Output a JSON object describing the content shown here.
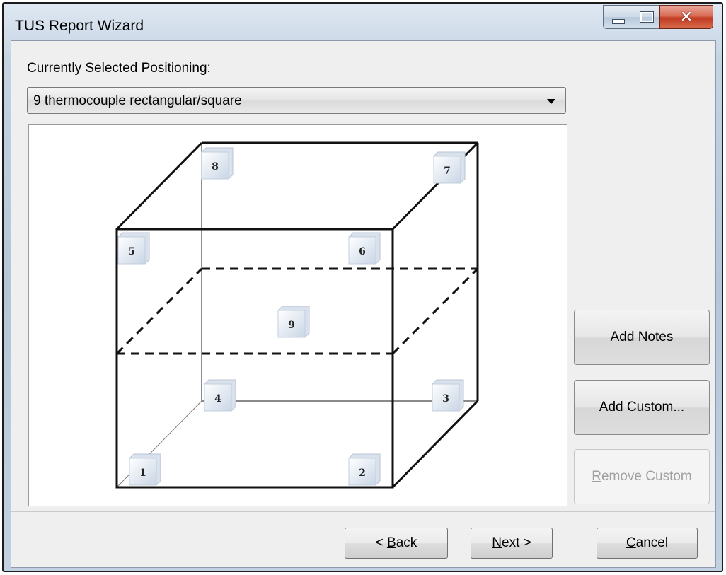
{
  "window": {
    "title": "TUS Report Wizard",
    "caption_icons": {
      "minimize": "minimize-icon",
      "maximize": "maximize-icon",
      "close": "close-icon"
    }
  },
  "positioning": {
    "label": "Currently Selected Positioning:",
    "selected": "9 thermocouple rectangular/square"
  },
  "diagram": {
    "markers": [
      "1",
      "2",
      "3",
      "4",
      "5",
      "6",
      "7",
      "8",
      "9"
    ]
  },
  "side_buttons": {
    "add_notes": "Add Notes",
    "add_custom_key": "A",
    "add_custom_rest": "dd Custom...",
    "remove_custom_key": "R",
    "remove_custom_rest": "emove Custom"
  },
  "footer": {
    "back_prefix": "< ",
    "back_key": "B",
    "back_rest": "ack",
    "next_key": "N",
    "next_rest": "ext >",
    "cancel_key": "C",
    "cancel_rest": "ancel"
  },
  "colors": {
    "close_button": "#c13c22",
    "title_bar": "#c8d6e5"
  }
}
